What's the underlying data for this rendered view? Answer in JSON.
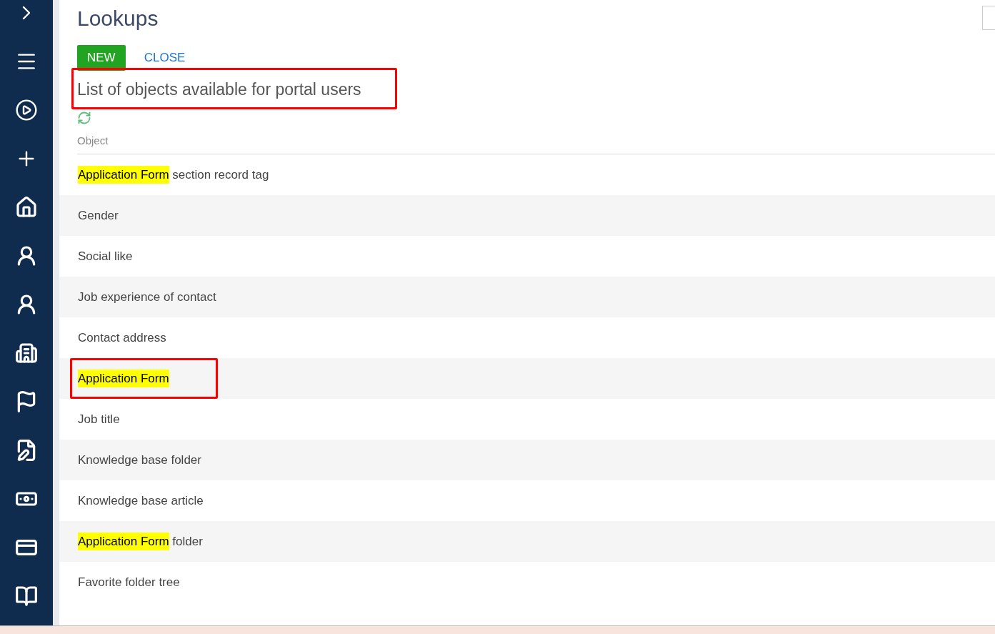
{
  "page_title": "Lookups",
  "actions": [
    {
      "label": "NEW",
      "kind": "primary"
    },
    {
      "label": "CLOSE",
      "kind": "link"
    }
  ],
  "section_title": {
    "text": "List of objects available for portal users",
    "annotated": true
  },
  "column_header": "Object",
  "rows": [
    {
      "segments": [
        {
          "text": "Application Form",
          "highlighted": true
        },
        {
          "text": " section record tag",
          "highlighted": false
        }
      ],
      "annotated": false
    },
    {
      "segments": [
        {
          "text": "Gender",
          "highlighted": false
        }
      ],
      "annotated": false
    },
    {
      "segments": [
        {
          "text": "Social like",
          "highlighted": false
        }
      ],
      "annotated": false
    },
    {
      "segments": [
        {
          "text": "Job experience of contact",
          "highlighted": false
        }
      ],
      "annotated": false
    },
    {
      "segments": [
        {
          "text": "Contact address",
          "highlighted": false
        }
      ],
      "annotated": false
    },
    {
      "segments": [
        {
          "text": "Application Form",
          "highlighted": true
        }
      ],
      "annotated": true
    },
    {
      "segments": [
        {
          "text": "Job title",
          "highlighted": false
        }
      ],
      "annotated": false
    },
    {
      "segments": [
        {
          "text": "Knowledge base folder",
          "highlighted": false
        }
      ],
      "annotated": false
    },
    {
      "segments": [
        {
          "text": "Knowledge base article",
          "highlighted": false
        }
      ],
      "annotated": false
    },
    {
      "segments": [
        {
          "text": "Application Form",
          "highlighted": true
        },
        {
          "text": " folder",
          "highlighted": false
        }
      ],
      "annotated": false
    },
    {
      "segments": [
        {
          "text": "Favorite folder tree",
          "highlighted": false
        }
      ],
      "annotated": false
    }
  ]
}
